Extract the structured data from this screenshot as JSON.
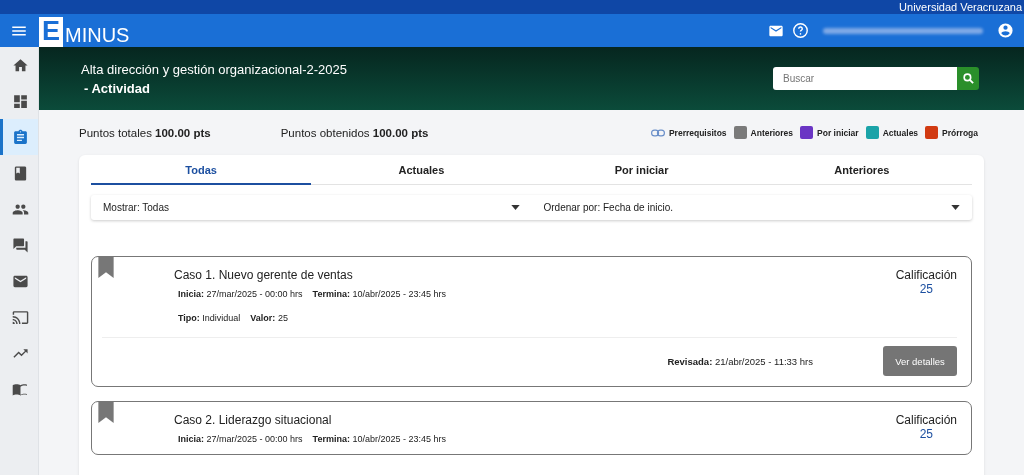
{
  "top_bar": {
    "institution": "Universidad Veracruzana"
  },
  "header": {
    "logo_letter": "E",
    "logo_text": "MINUS"
  },
  "sidebar": {
    "items": [
      {
        "selected": false
      },
      {
        "selected": false
      },
      {
        "selected": true
      },
      {
        "selected": false
      },
      {
        "selected": false
      },
      {
        "selected": false
      },
      {
        "selected": false
      },
      {
        "selected": false
      },
      {
        "selected": false
      },
      {
        "selected": false
      }
    ]
  },
  "banner": {
    "course": "Alta dirección y gestión organizacional-2-2025",
    "section": "- Actividad",
    "search": {
      "placeholder": "Buscar"
    }
  },
  "points": [
    {
      "label": "Puntos totales",
      "value": "100.00 pts"
    },
    {
      "label": "Puntos obtenidos",
      "value": "100.00 pts"
    }
  ],
  "legend": {
    "prereq": "Prerrequisitos",
    "items": [
      {
        "label": "Anteriores",
        "color": "#7a7a7a"
      },
      {
        "label": "Por iniciar",
        "color": "#6a35c4"
      },
      {
        "label": "Actuales",
        "color": "#1aa3a8"
      },
      {
        "label": "Prórroga",
        "color": "#d13a12"
      }
    ]
  },
  "tabs": [
    {
      "label": "Todas",
      "selected": true
    },
    {
      "label": "Actuales",
      "selected": false
    },
    {
      "label": "Por iniciar",
      "selected": false
    },
    {
      "label": "Anteriores",
      "selected": false
    }
  ],
  "filters": [
    {
      "label": "Mostrar:",
      "value": "Todas"
    },
    {
      "label": "Ordenar por:",
      "value": "Fecha de inicio."
    }
  ],
  "activities": [
    {
      "title": "Caso 1. Nuevo gerente de ventas",
      "start_label": "Inicia:",
      "start": "27/mar/2025 - 00:00 hrs",
      "end_label": "Termina:",
      "end": "10/abr/2025 - 23:45 hrs",
      "type_label": "Tipo:",
      "type": "Individual",
      "value_label": "Valor:",
      "value": "25",
      "grade_label": "Calificación",
      "grade": "25",
      "reviewed_label": "Revisada:",
      "reviewed": "21/abr/2025 - 11:33 hrs",
      "button": "Ver detalles"
    },
    {
      "title": "Caso 2. Liderazgo situacional",
      "start_label": "Inicia:",
      "start": "27/mar/2025 - 00:00 hrs",
      "end_label": "Termina:",
      "end": "10/abr/2025 - 23:45 hrs",
      "grade_label": "Calificación",
      "grade": "25"
    }
  ]
}
